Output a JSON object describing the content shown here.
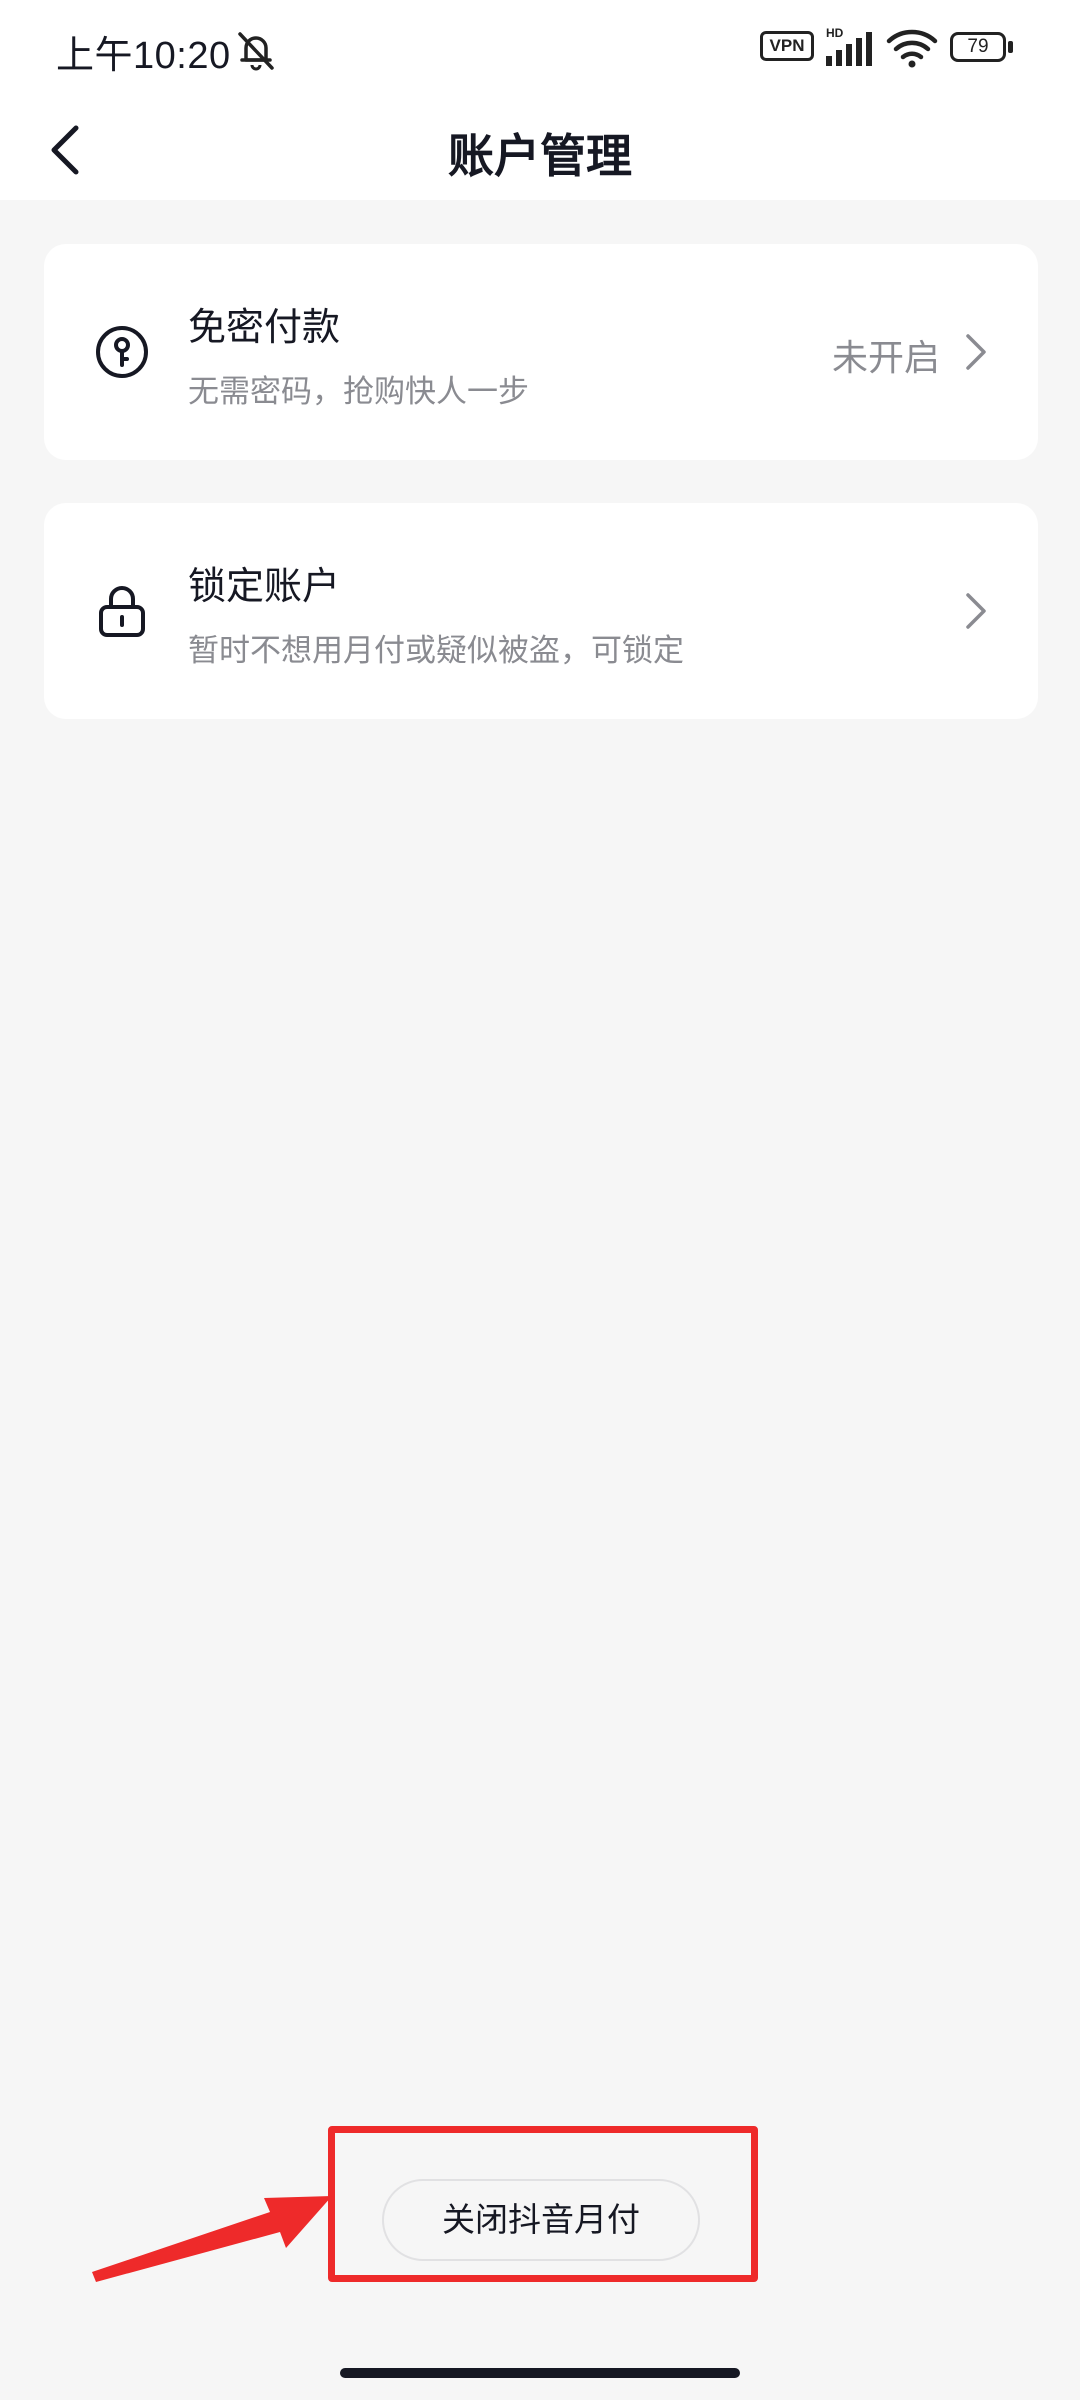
{
  "status_bar": {
    "time": "上午10:20",
    "vpn_label": "VPN",
    "network_label": "HD",
    "battery_level": "79"
  },
  "nav": {
    "title": "账户管理"
  },
  "settings": [
    {
      "title": "免密付款",
      "description": "无需密码，抢购快人一步",
      "status": "未开启",
      "icon": "password-free-key-icon"
    },
    {
      "title": "锁定账户",
      "description": "暂时不想用月付或疑似被盗，可锁定",
      "status": "",
      "icon": "lock-icon"
    }
  ],
  "footer": {
    "close_button_label": "关闭抖音月付"
  },
  "colors": {
    "background": "#f6f6f6",
    "card": "#ffffff",
    "primary_text": "#161823",
    "secondary_text": "#8a8b91",
    "annotation_red": "#ee2a2a"
  }
}
